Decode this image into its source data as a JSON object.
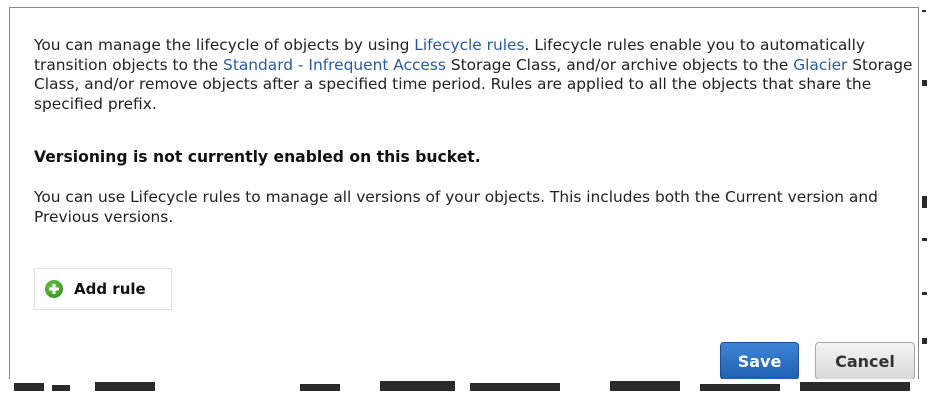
{
  "intro": {
    "text_1": "You can manage the lifecycle of objects by using ",
    "link_lifecycle": "Lifecycle rules",
    "text_2": ". Lifecycle rules enable you to automatically transition objects to the ",
    "link_standard_ia": "Standard - Infrequent Access",
    "text_3": " Storage Class, and/or archive objects to the ",
    "link_glacier": "Glacier",
    "text_4": " Storage Class, and/or remove objects after a specified time period. Rules are applied to all the objects that share the specified prefix."
  },
  "versioning": {
    "heading": "Versioning is not currently enabled on this bucket.",
    "text": "You can use Lifecycle rules to manage all versions of your objects. This includes both the Current version and Previous versions."
  },
  "actions": {
    "add_rule_label": "Add rule",
    "add_rule_icon": "plus-circle-icon",
    "save_label": "Save",
    "cancel_label": "Cancel"
  },
  "colors": {
    "link": "#2a5a9b",
    "save_button": "#2a6fc9",
    "add_icon": "#4aa52e"
  }
}
